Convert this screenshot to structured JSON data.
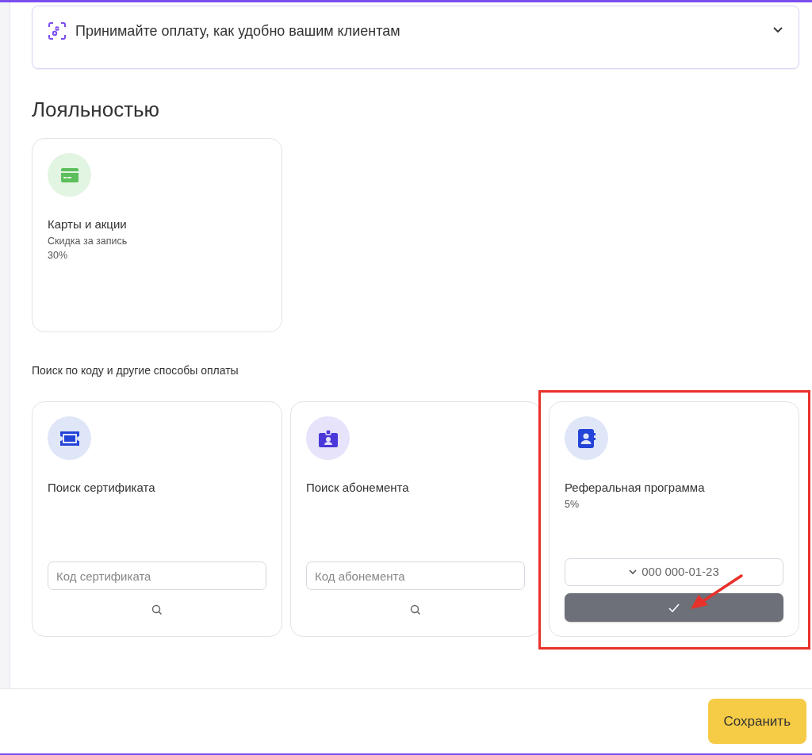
{
  "accordion": {
    "title": "Принимайте оплату, как удобно вашим клиентам",
    "expanded": false
  },
  "loyalty": {
    "heading": "Лояльностью",
    "cards": [
      {
        "title": "Карты и акции",
        "lines": [
          "Скидка за запись",
          "30%"
        ]
      }
    ]
  },
  "payment": {
    "heading": "Поиск по коду и другие способы оплаты",
    "cards": [
      {
        "kind": "search",
        "title": "Поиск сертификата",
        "placeholder": "Код сертификата",
        "highlighted": false
      },
      {
        "kind": "search",
        "title": "Поиск абонемента",
        "placeholder": "Код абонемента",
        "highlighted": false
      },
      {
        "kind": "referral",
        "title": "Реферальная программа",
        "lines": [
          "5%"
        ],
        "select_value": "000 000-01-23",
        "highlighted": true
      }
    ]
  },
  "footer": {
    "save_button": "Сохранить"
  }
}
